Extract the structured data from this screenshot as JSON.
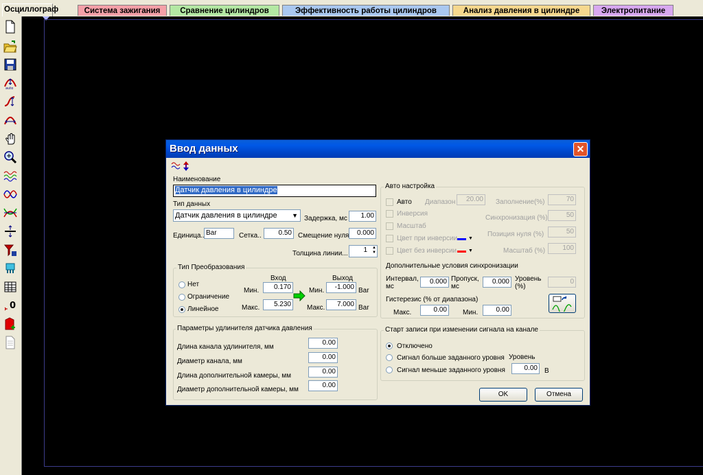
{
  "tabs": [
    {
      "label": "Осциллограф",
      "color": "#ece9d8",
      "active": true
    },
    {
      "label": "Система зажигания",
      "color": "#f4a0a8"
    },
    {
      "label": "Сравнение цилиндров",
      "color": "#b4e8a4"
    },
    {
      "label": "Эффективность работы цилиндров",
      "color": "#aac8f0"
    },
    {
      "label": "Анализ давления в цилиндре",
      "color": "#f6d88e"
    },
    {
      "label": "Электропитание",
      "color": "#d8a8f0"
    }
  ],
  "toolbar_icons": [
    "new-file-icon",
    "open-folder-icon",
    "save-disk-icon",
    "auto-scale-icon",
    "cursor-measure-icon",
    "sync-icon",
    "hand-pan-icon",
    "zoom-icon",
    "signal-channel-icon",
    "signal-channel-2-icon",
    "signal-channel-3-icon",
    "level-icon",
    "filter-icon",
    "sensor-icon",
    "table-icon",
    "zero-icon",
    "channel-add-icon",
    "document-icon"
  ],
  "dialog": {
    "title": "Ввод данных",
    "close": "✕",
    "name_label": "Наименование",
    "name_value": "Датчик давления в цилиндре",
    "datatype_label": "Тип данных",
    "datatype_value": "Датчик давления в цилиндре",
    "delay_label": "Задержка, мс",
    "delay_value": "1.00",
    "unit_label": "Единица..",
    "unit_value": "Bar",
    "grid_label": "Сетка..",
    "grid_value": "0.50",
    "offset_label": "Смещение нуля",
    "offset_value": "0.000",
    "thickness_label": "Толщина линии...",
    "thickness_value": "1",
    "conversion": {
      "group_label": "Тип Преобразования",
      "options": [
        "Нет",
        "Ограничение",
        "Линейное"
      ],
      "selected": "Линейное",
      "input_header": "Вход",
      "output_header": "Выход",
      "min_label": "Мин.",
      "max_label": "Макс.",
      "in_min": "0.170",
      "in_max": "5.230",
      "out_min": "-1.000",
      "out_max": "7.000",
      "unit": "Bar"
    },
    "extension": {
      "group_label": "Параметры удлинителя датчика давления",
      "rows": [
        {
          "label": "Длина канала удлинителя, мм",
          "value": "0.00"
        },
        {
          "label": "Диаметр канала, мм",
          "value": "0.00"
        },
        {
          "label": "Длина дополнительной камеры, мм",
          "value": "0.00"
        },
        {
          "label": "Диаметр дополнительной камеры, мм",
          "value": "0.00"
        }
      ]
    },
    "auto": {
      "group_label": "Авто настройка",
      "auto_label": "Авто",
      "range_label": "Диапазон",
      "range_value": "20.00",
      "fill_label": "Заполнение(%)",
      "fill_value": "70",
      "inversion_label": "Инверсия",
      "sync_label": "Синхронизация (%)",
      "sync_value": "50",
      "scale_label": "Масштаб",
      "zero_pos_label": "Позиция нуля (%)",
      "zero_pos_value": "50",
      "color_inv_label": "Цвет при инверсии",
      "color_inv": "#0000ff",
      "color_noinv_label": "Цвет без инверсии",
      "color_noinv": "#ff0000",
      "scale_pct_label": "Масштаб (%)",
      "scale_pct_value": "100"
    },
    "sync": {
      "group_label": "Дополнительные условия синхронизации",
      "interval_label": "Интервал, мс",
      "interval_value": "0.000",
      "skip_label": "Пропуск, мс",
      "skip_value": "0.000",
      "level_label": "Уровень (%)",
      "level_value": "0",
      "hyst_label": "Гистерезис (% от диапазона)",
      "max_label": "Макс.",
      "max_value": "0.00",
      "min_label": "Мин.",
      "min_value": "0.00"
    },
    "record": {
      "group_label": "Старт записи при изменении сигнала на канале",
      "options": [
        "Отключено",
        "Сигнал больше заданного уровня",
        "Сигнал меньше заданного уровня"
      ],
      "selected": "Отключено",
      "level_label": "Уровень",
      "level_value": "0.00",
      "level_unit": "В"
    },
    "ok": "OK",
    "cancel": "Отмена"
  }
}
